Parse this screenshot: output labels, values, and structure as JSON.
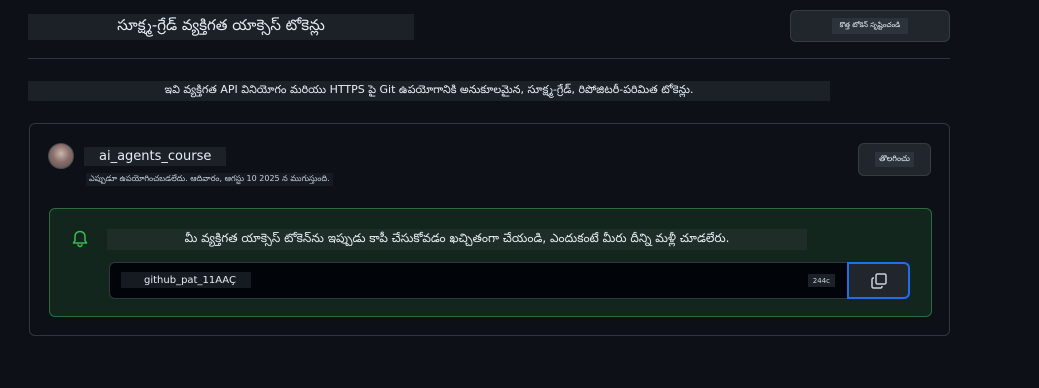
{
  "header": {
    "title": "సూక్ష్మ-గ్రేడ్ వ్యక్తిగత యాక్సెస్ టోకెన్లు",
    "generate_button_label": "కొత్త టోకెన్ సృష్టించండి"
  },
  "description": "ఇవి వ్యక్తిగత API వినియోగం మరియు HTTPS పై Git ఉపయోగానికి అనుకూలమైన, సూక్ష్మ-గ్రేడ్, రిపోజిటరీ-పరిమిత టోకెన్లు.",
  "token": {
    "name": "ai_agents_course",
    "meta": "ఎప్పుడూ ఉపయోగించబడలేదు. ఆదివారం, ఆగస్టు 10 2025 న ముగుస్తుంది.",
    "delete_button_label": "తొలగించు"
  },
  "flash": {
    "message": "మీ వ్యక్తిగత యాక్సెస్ టోకెన్‌ను ఇప్పుడు కాపీ చేసుకోవడం ఖచ్చితంగా చేయండి, ఎందుకంటే మీరు దీన్ని మళ్లీ చూడలేరు.",
    "token_value": "github_pat_11AAÇ",
    "token_count": "244c",
    "icon": "bell-icon",
    "copy_icon": "copy-icon"
  },
  "colors": {
    "background": "#0d1117",
    "flash_border": "#2e6b3f",
    "flash_background": "#12261e",
    "accent": "#1f6feb",
    "success_icon": "#3fb950"
  }
}
